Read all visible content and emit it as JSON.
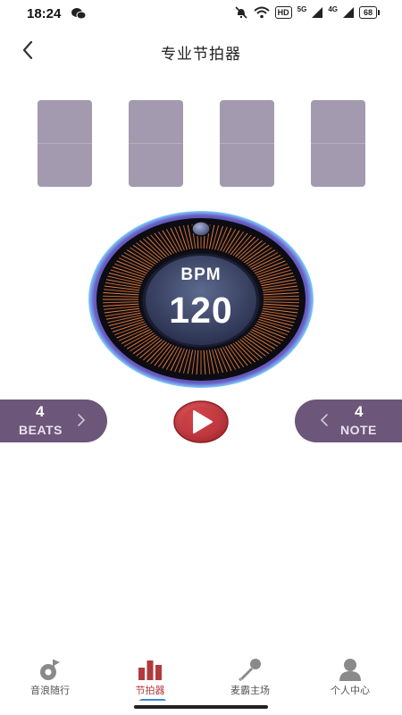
{
  "status_bar": {
    "time": "18:24",
    "network_hd": "HD",
    "signal_1": "5G",
    "signal_2": "4G",
    "battery": "68"
  },
  "header": {
    "title": "专业节拍器",
    "back_icon": "chevron-left-icon"
  },
  "beat_cards": [
    {
      "index": 1,
      "color": "#a49aaf"
    },
    {
      "index": 2,
      "color": "#a49aaf"
    },
    {
      "index": 3,
      "color": "#a49aaf"
    },
    {
      "index": 4,
      "color": "#a49aaf"
    }
  ],
  "dial": {
    "label": "BPM",
    "value": "120"
  },
  "beats_control": {
    "value": "4",
    "label": "BEATS"
  },
  "note_control": {
    "value": "4",
    "label": "NOTE"
  },
  "play_button": {
    "icon": "play-icon",
    "color": "#c4393e"
  },
  "bottom_nav": {
    "items": [
      {
        "label": "音浪随行",
        "icon": "music-note-icon",
        "active": false
      },
      {
        "label": "节拍器",
        "icon": "bars-icon",
        "active": true
      },
      {
        "label": "麦霸主场",
        "icon": "microphone-icon",
        "active": false
      },
      {
        "label": "个人中心",
        "icon": "person-icon",
        "active": false
      }
    ]
  },
  "colors": {
    "accent": "#b23a3a",
    "control_bg": "#6c5679",
    "card": "#a49aaf",
    "dial_ring": "#5a4fa8"
  }
}
